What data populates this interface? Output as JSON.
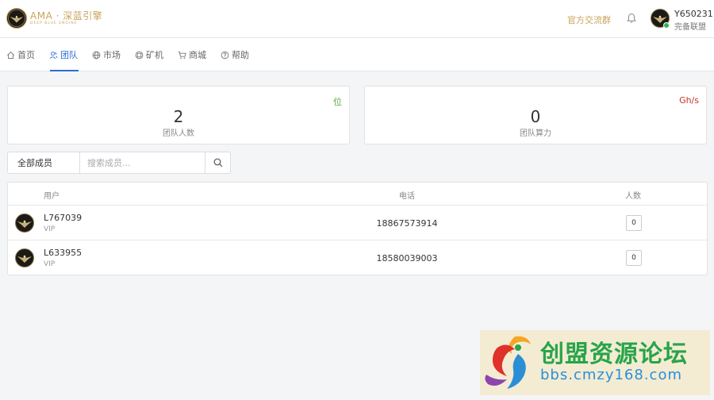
{
  "app": {
    "logo_main": "AMA · 深蓝引擎",
    "logo_sub": "DEEP BLUE ENGINE"
  },
  "header": {
    "group_link": "官方交流群",
    "user_id": "Y650231",
    "user_subtitle": "完备联盟"
  },
  "nav": [
    {
      "label": "首页",
      "icon": "home-icon"
    },
    {
      "label": "团队",
      "icon": "team-icon",
      "active": true
    },
    {
      "label": "市场",
      "icon": "globe-icon"
    },
    {
      "label": "矿机",
      "icon": "miner-icon"
    },
    {
      "label": "商城",
      "icon": "cart-icon"
    },
    {
      "label": "帮助",
      "icon": "help-icon"
    }
  ],
  "stats": [
    {
      "value": "2",
      "label": "团队人数",
      "unit": "位",
      "unit_color": "#5aa83c"
    },
    {
      "value": "0",
      "label": "团队算力",
      "unit": "Gh/s",
      "unit_color": "#c0392b"
    }
  ],
  "filter": {
    "select_label": "全部成员",
    "search_placeholder": "搜索成员..."
  },
  "table": {
    "columns": [
      "用户",
      "电话",
      "人数"
    ],
    "rows": [
      {
        "user": "L767039",
        "level": "VIP",
        "phone": "18867573914",
        "count": "0"
      },
      {
        "user": "L633955",
        "level": "VIP",
        "phone": "18580039003",
        "count": "0"
      }
    ]
  },
  "watermark": {
    "title": "创盟资源论坛",
    "url": "bbs.cmzy168.com"
  },
  "colors": {
    "accent": "#2d6cd6",
    "gold": "#c9a35a"
  }
}
